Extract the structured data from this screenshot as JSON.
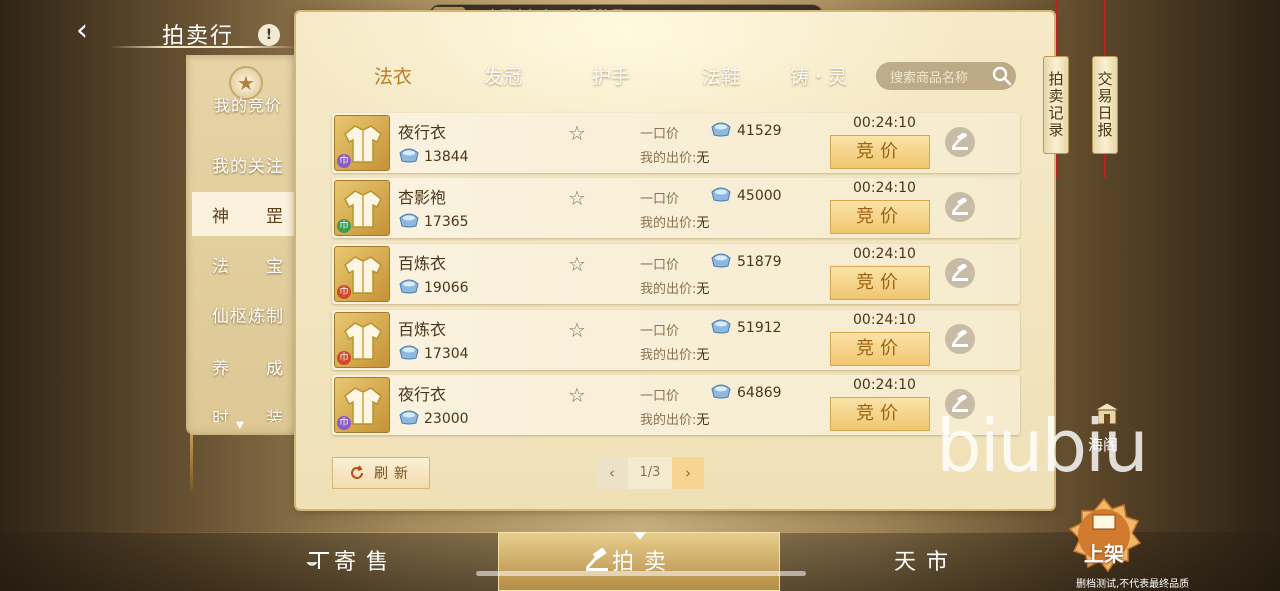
{
  "ticker": {
    "tag": "阵灵",
    "text": "ヒ唤灵中拓印了碧瑶阵灵。"
  },
  "header": {
    "back_icon": "‹",
    "title": "拍卖行",
    "info_icon": "!"
  },
  "left_nav": {
    "my_bids": "我的竞价",
    "items": [
      "我的关注",
      "神罡",
      "法宝",
      "仙枢炼制",
      "养成",
      "时装"
    ]
  },
  "tabs": [
    "法衣",
    "发冠",
    "护手",
    "法鞋",
    "铸・灵"
  ],
  "search": {
    "placeholder": "搜索商品名称"
  },
  "labels": {
    "buyout": "一口价",
    "my_bid": "我的出价:",
    "my_bid_value": "无",
    "bid_button": "竞价"
  },
  "items": [
    {
      "name": "夜行衣",
      "current": "13844",
      "buyout": "41529",
      "timer": "00:24:10",
      "gem_color": "#8a5cc8",
      "gem": "巾"
    },
    {
      "name": "杏影袍",
      "current": "17365",
      "buyout": "45000",
      "timer": "00:24:10",
      "gem_color": "#3f9a52",
      "gem": "巾"
    },
    {
      "name": "百炼衣",
      "current": "19066",
      "buyout": "51879",
      "timer": "00:24:10",
      "gem_color": "#d04a2a",
      "gem": "巾"
    },
    {
      "name": "百炼衣",
      "current": "17304",
      "buyout": "51912",
      "timer": "00:24:10",
      "gem_color": "#d04a2a",
      "gem": "巾"
    },
    {
      "name": "夜行衣",
      "current": "23000",
      "buyout": "64869",
      "timer": "00:24:10",
      "gem_color": "#8a5cc8",
      "gem": "巾"
    }
  ],
  "footer": {
    "refresh": "刷新",
    "page": "1/3"
  },
  "right": {
    "auction_record": "拍卖记录",
    "trade_daily": "交易日报",
    "haige": "海阁"
  },
  "bottom_tabs": {
    "consign": "寄售",
    "auction": "拍卖",
    "market": "天市"
  },
  "list_button": "上架",
  "disclaimer": "删档测试,不代表最终品质",
  "watermark": "biubiu",
  "colors": {
    "accent": "#b9812c",
    "panel": "#f6e9c6",
    "bid_button": "#f0c670"
  }
}
